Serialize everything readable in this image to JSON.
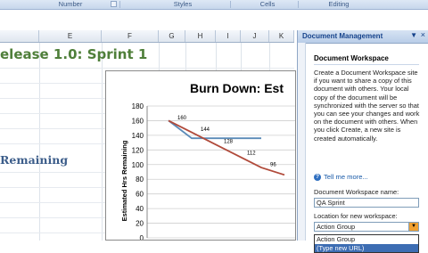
{
  "ribbon": {
    "groups": [
      "Number",
      "Styles",
      "Cells",
      "Editing"
    ]
  },
  "columns": [
    "E",
    "F",
    "G",
    "H",
    "I",
    "J",
    "K"
  ],
  "sheet": {
    "title": "elease 1.0: Sprint 1",
    "remaining_label": "Remaining"
  },
  "chart_data": {
    "type": "line",
    "title": "Burn Down: Est",
    "ylabel": "Estimated Hrs Remaining",
    "ylim": [
      0,
      180
    ],
    "yticks": [
      "0",
      "20",
      "40",
      "60",
      "80",
      "100",
      "120",
      "140",
      "160",
      "180"
    ],
    "grid": true,
    "series": [
      {
        "color": "#5b8bb8",
        "x": [
          0,
          1,
          2,
          3,
          4
        ],
        "values": [
          160,
          136,
          136,
          136,
          136
        ]
      },
      {
        "color": "#b04a3a",
        "x": [
          0,
          1,
          2,
          3,
          4,
          5
        ],
        "values": [
          160,
          144,
          128,
          112,
          96,
          86
        ],
        "labels": [
          "160",
          "144",
          "128",
          "112",
          "96",
          ""
        ]
      }
    ],
    "colors": {
      "grid": "#cfcfcf",
      "axis": "#888888"
    }
  },
  "task_pane": {
    "title": "Document Management",
    "heading": "Document Workspace",
    "description": "Create a Document Workspace site if you want to share a copy of this document with others. Your local copy of the document will be synchronized with the server so that you can see your changes and work on the document with others. When you click Create, a new site is created automatically.",
    "help_link": "Tell me more...",
    "name_label": "Document Workspace name:",
    "name_value": "QA Sprint",
    "location_label": "Location for new workspace:",
    "location_value": "Action Group",
    "location_options": [
      "Action Group",
      "(Type new URL)"
    ]
  }
}
